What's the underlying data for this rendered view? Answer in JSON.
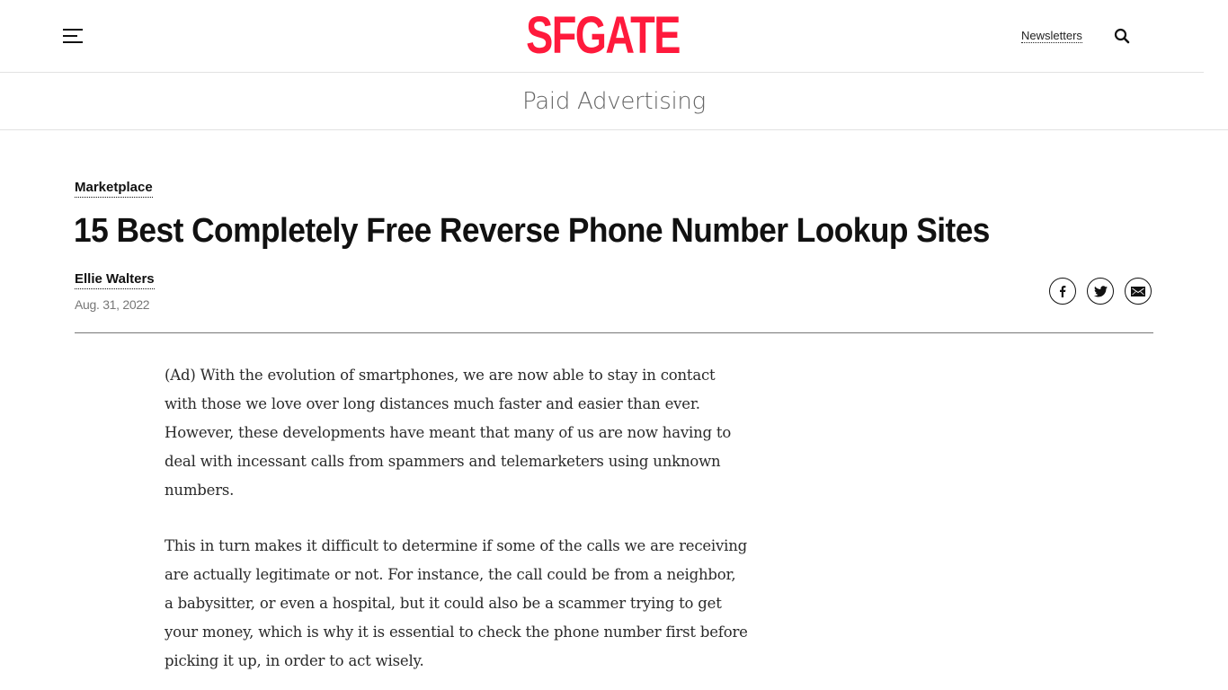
{
  "header": {
    "menu_icon": "hamburger-menu-icon",
    "logo_text": "SFGATE",
    "logo_color": "#ff1a3c",
    "newsletters_label": "Newsletters",
    "search_icon": "search-icon"
  },
  "ad_banner": {
    "label": "Paid Advertising"
  },
  "article": {
    "category": "Marketplace",
    "title": "15 Best Completely Free Reverse Phone Number Lookup Sites",
    "author": "Ellie Walters",
    "date": "Aug. 31, 2022",
    "share": [
      {
        "name": "facebook",
        "icon": "facebook-icon"
      },
      {
        "name": "twitter",
        "icon": "twitter-icon"
      },
      {
        "name": "email",
        "icon": "email-icon"
      }
    ],
    "paragraphs": [
      "(Ad) With the evolution of smartphones, we are now able to stay in contact with those we love over long distances much faster and easier than ever. However, these developments have meant that many of us are now having to deal with incessant calls from spammers and telemarketers using unknown numbers.",
      "This in turn makes it difficult to determine if some of the calls we are receiving are actually legitimate or not. For instance, the call could be from a neighbor, a babysitter, or even a hospital, but it could also be a scammer trying to get your money, which is why it is essential to check the phone number first before picking it up, in order to act wisely."
    ]
  }
}
